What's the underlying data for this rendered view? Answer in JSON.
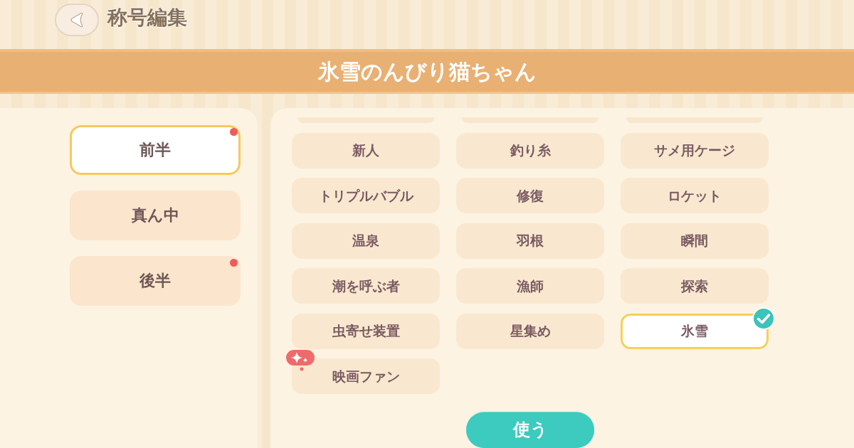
{
  "header": {
    "title": "称号編集"
  },
  "banner": {
    "title": "氷雪のんびり猫ちゃん"
  },
  "tabs": [
    {
      "label": "前半",
      "selected": true,
      "notification": true
    },
    {
      "label": "真ん中",
      "selected": false,
      "notification": false
    },
    {
      "label": "後半",
      "selected": false,
      "notification": true
    }
  ],
  "titles": [
    {
      "label": "新人",
      "selected": false,
      "new": false
    },
    {
      "label": "釣り糸",
      "selected": false,
      "new": false
    },
    {
      "label": "サメ用ケージ",
      "selected": false,
      "new": false
    },
    {
      "label": "トリプルバブル",
      "selected": false,
      "new": false
    },
    {
      "label": "修復",
      "selected": false,
      "new": false
    },
    {
      "label": "ロケット",
      "selected": false,
      "new": false
    },
    {
      "label": "温泉",
      "selected": false,
      "new": false
    },
    {
      "label": "羽根",
      "selected": false,
      "new": false
    },
    {
      "label": "瞬間",
      "selected": false,
      "new": false
    },
    {
      "label": "潮を呼ぶ者",
      "selected": false,
      "new": false
    },
    {
      "label": "漁師",
      "selected": false,
      "new": false
    },
    {
      "label": "探索",
      "selected": false,
      "new": false
    },
    {
      "label": "虫寄せ装置",
      "selected": false,
      "new": false
    },
    {
      "label": "星集め",
      "selected": false,
      "new": false
    },
    {
      "label": "氷雪",
      "selected": true,
      "new": false
    },
    {
      "label": "映画ファン",
      "selected": false,
      "new": true
    }
  ],
  "use_button": {
    "label": "使う"
  }
}
